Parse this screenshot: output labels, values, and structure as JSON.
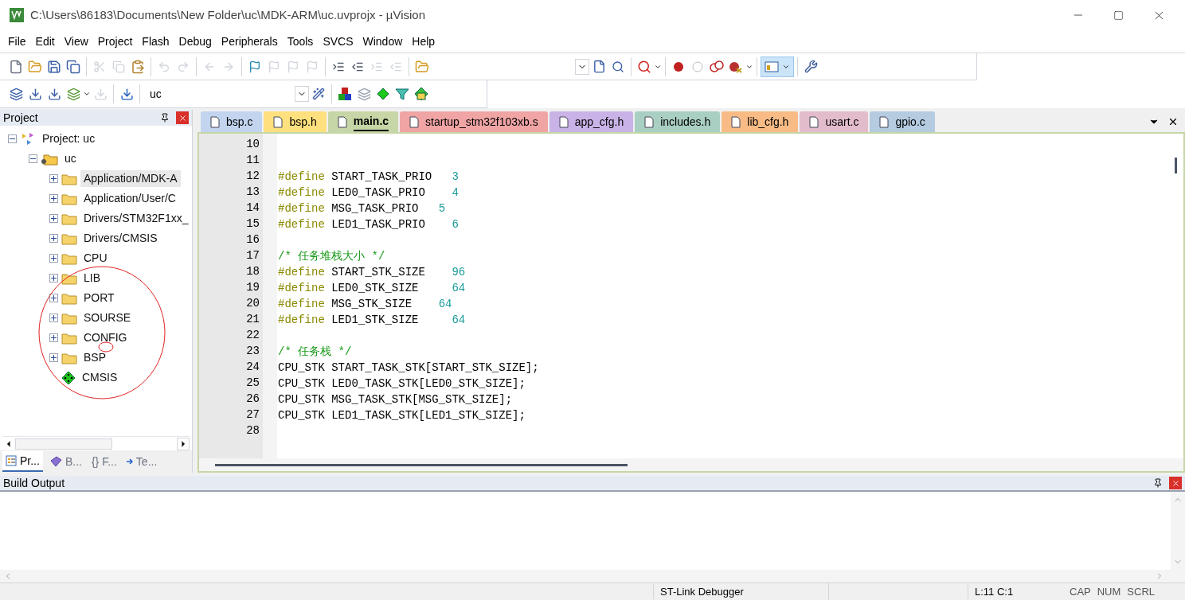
{
  "window": {
    "title": "C:\\Users\\86183\\Documents\\New Folder\\uc\\MDK-ARM\\uc.uvprojx - µVision"
  },
  "menu": [
    "File",
    "Edit",
    "View",
    "Project",
    "Flash",
    "Debug",
    "Peripherals",
    "Tools",
    "SVCS",
    "Window",
    "Help"
  ],
  "target_select": {
    "value": "uc"
  },
  "project_panel": {
    "title": "Project",
    "tree": [
      {
        "label": "Project: uc",
        "kind": "project",
        "expanded": true,
        "selected": false,
        "children": [
          {
            "label": "uc",
            "kind": "target",
            "expanded": true,
            "selected": false,
            "children": [
              {
                "label": "Application/MDK-A",
                "kind": "folder",
                "expanded": false,
                "selected": true
              },
              {
                "label": "Application/User/C",
                "kind": "folder",
                "expanded": false,
                "selected": false
              },
              {
                "label": "Drivers/STM32F1xx_",
                "kind": "folder",
                "expanded": false,
                "selected": false
              },
              {
                "label": "Drivers/CMSIS",
                "kind": "folder",
                "expanded": false,
                "selected": false
              },
              {
                "label": "CPU",
                "kind": "folder",
                "expanded": false,
                "selected": false
              },
              {
                "label": "LIB",
                "kind": "folder",
                "expanded": false,
                "selected": false
              },
              {
                "label": "PORT",
                "kind": "folder",
                "expanded": false,
                "selected": false
              },
              {
                "label": "SOURSE",
                "kind": "folder",
                "expanded": false,
                "selected": false
              },
              {
                "label": "CONFIG",
                "kind": "folder",
                "expanded": false,
                "selected": false
              },
              {
                "label": "BSP",
                "kind": "folder",
                "expanded": false,
                "selected": false
              },
              {
                "label": "CMSIS",
                "kind": "component",
                "selected": false
              }
            ]
          }
        ]
      }
    ],
    "tabs": [
      {
        "label": "Pr...",
        "kind": "project",
        "selected": true
      },
      {
        "label": "B...",
        "kind": "books",
        "selected": false
      },
      {
        "label": "{}",
        "kind": "functions",
        "selected": false,
        "suffix": "F..."
      },
      {
        "label": "Te...",
        "kind": "templates",
        "selected": false
      }
    ]
  },
  "editor_tabs": [
    {
      "label": "bsp.c",
      "color": "#c2d4ee",
      "selected": false
    },
    {
      "label": "bsp.h",
      "color": "#ffe07e",
      "selected": false
    },
    {
      "label": "main.c",
      "color": "#c6d6a6",
      "selected": true
    },
    {
      "label": "startup_stm32f103xb.s",
      "color": "#f0a4a4",
      "selected": false
    },
    {
      "label": "app_cfg.h",
      "color": "#c9b3e6",
      "selected": false
    },
    {
      "label": "includes.h",
      "color": "#a9cfc2",
      "selected": false
    },
    {
      "label": "lib_cfg.h",
      "color": "#f8bb86",
      "selected": false
    },
    {
      "label": "usart.c",
      "color": "#e3bccb",
      "selected": false
    },
    {
      "label": "gpio.c",
      "color": "#b4cbe0",
      "selected": false
    }
  ],
  "code": [
    {
      "number": "10"
    },
    {
      "number": "11"
    },
    {
      "number": "12",
      "tokens": [
        {
          "kind": "keyword",
          "text": "#define"
        },
        {
          "kind": "text",
          "text": " START_TASK_PRIO   "
        },
        {
          "kind": "number",
          "text": "3"
        }
      ]
    },
    {
      "number": "13",
      "tokens": [
        {
          "kind": "keyword",
          "text": "#define"
        },
        {
          "kind": "text",
          "text": " LED0_TASK_PRIO    "
        },
        {
          "kind": "number",
          "text": "4"
        }
      ]
    },
    {
      "number": "14",
      "tokens": [
        {
          "kind": "keyword",
          "text": "#define"
        },
        {
          "kind": "text",
          "text": " MSG_TASK_PRIO   "
        },
        {
          "kind": "number",
          "text": "5"
        }
      ]
    },
    {
      "number": "15",
      "tokens": [
        {
          "kind": "keyword",
          "text": "#define"
        },
        {
          "kind": "text",
          "text": " LED1_TASK_PRIO    "
        },
        {
          "kind": "number",
          "text": "6"
        }
      ]
    },
    {
      "number": "16"
    },
    {
      "number": "17",
      "tokens": [
        {
          "kind": "comment",
          "text": "/* 任务堆栈大小 */"
        }
      ]
    },
    {
      "number": "18",
      "tokens": [
        {
          "kind": "keyword",
          "text": "#define"
        },
        {
          "kind": "text",
          "text": " START_STK_SIZE    "
        },
        {
          "kind": "number",
          "text": "96"
        }
      ]
    },
    {
      "number": "19",
      "tokens": [
        {
          "kind": "keyword",
          "text": "#define"
        },
        {
          "kind": "text",
          "text": " LED0_STK_SIZE     "
        },
        {
          "kind": "number",
          "text": "64"
        }
      ]
    },
    {
      "number": "20",
      "tokens": [
        {
          "kind": "keyword",
          "text": "#define"
        },
        {
          "kind": "text",
          "text": " MSG_STK_SIZE    "
        },
        {
          "kind": "number",
          "text": "64"
        }
      ]
    },
    {
      "number": "21",
      "tokens": [
        {
          "kind": "keyword",
          "text": "#define"
        },
        {
          "kind": "text",
          "text": " LED1_STK_SIZE     "
        },
        {
          "kind": "number",
          "text": "64"
        }
      ]
    },
    {
      "number": "22"
    },
    {
      "number": "23",
      "tokens": [
        {
          "kind": "comment",
          "text": "/* 任务栈 */"
        }
      ]
    },
    {
      "number": "24",
      "tokens": [
        {
          "kind": "text",
          "text": "CPU_STK START_TASK_STK[START_STK_SIZE];"
        }
      ]
    },
    {
      "number": "25",
      "tokens": [
        {
          "kind": "text",
          "text": "CPU_STK LED0_TASK_STK[LED0_STK_SIZE];"
        }
      ]
    },
    {
      "number": "26",
      "tokens": [
        {
          "kind": "text",
          "text": "CPU_STK MSG_TASK_STK[MSG_STK_SIZE];"
        }
      ]
    },
    {
      "number": "27",
      "tokens": [
        {
          "kind": "text",
          "text": "CPU_STK LED1_TASK_STK[LED1_STK_SIZE];"
        }
      ]
    },
    {
      "number": "28"
    }
  ],
  "build_output": {
    "title": "Build Output"
  },
  "status_bar": {
    "debugger": "ST-Link Debugger",
    "position": "L:11 C:1",
    "indicators": [
      "CAP",
      "NUM",
      "SCRL"
    ]
  }
}
